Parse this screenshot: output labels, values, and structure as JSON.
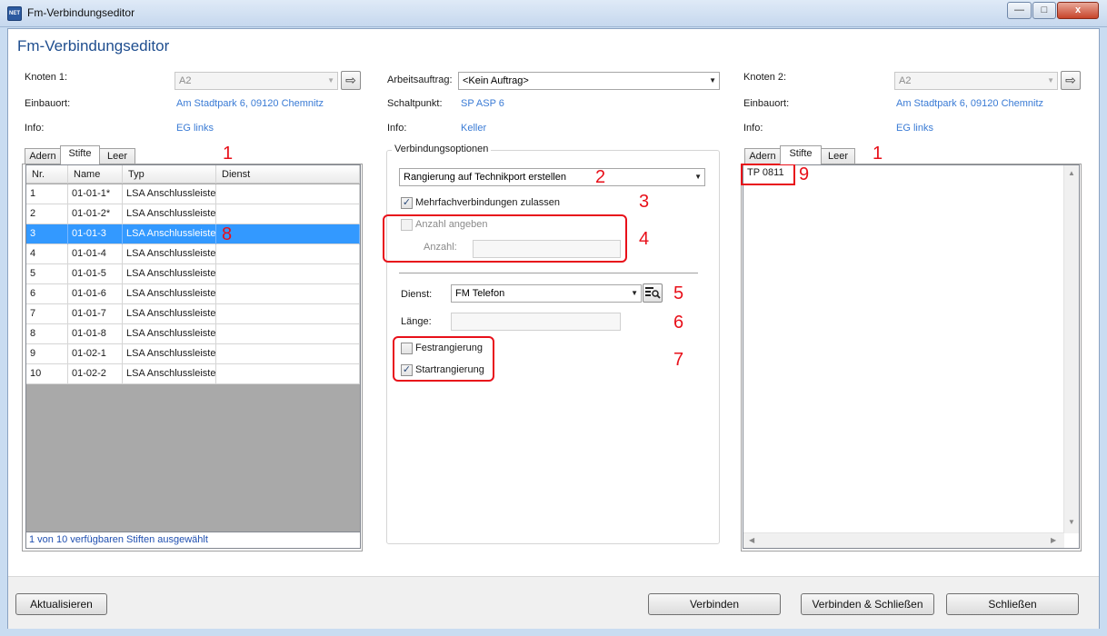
{
  "window": {
    "title": "Fm-Verbindungseditor",
    "app_icon_text": "NET",
    "minimize_glyph": "—",
    "maximize_glyph": "□",
    "close_glyph": "x"
  },
  "heading": "Fm-Verbindungseditor",
  "left": {
    "knoten_label": "Knoten 1:",
    "knoten_value": "A2",
    "einbauort_label": "Einbauort:",
    "einbauort_value": "Am Stadtpark 6, 09120 Chemnitz",
    "info_label": "Info:",
    "info_value": "EG links",
    "tabs": [
      {
        "label": "Adern",
        "active": false
      },
      {
        "label": "Stifte",
        "active": true
      },
      {
        "label": "Leer",
        "active": false
      }
    ],
    "grid": {
      "columns": [
        "Nr.",
        "Name",
        "Typ",
        "Dienst"
      ],
      "rows": [
        {
          "nr": "1",
          "name": "01-01-1*",
          "typ": "LSA Anschlussleiste",
          "dienst": "",
          "selected": false
        },
        {
          "nr": "2",
          "name": "01-01-2*",
          "typ": "LSA Anschlussleiste",
          "dienst": "",
          "selected": false
        },
        {
          "nr": "3",
          "name": "01-01-3",
          "typ": "LSA Anschlussleiste",
          "dienst": "",
          "selected": true
        },
        {
          "nr": "4",
          "name": "01-01-4",
          "typ": "LSA Anschlussleiste",
          "dienst": "",
          "selected": false
        },
        {
          "nr": "5",
          "name": "01-01-5",
          "typ": "LSA Anschlussleiste",
          "dienst": "",
          "selected": false
        },
        {
          "nr": "6",
          "name": "01-01-6",
          "typ": "LSA Anschlussleiste",
          "dienst": "",
          "selected": false
        },
        {
          "nr": "7",
          "name": "01-01-7",
          "typ": "LSA Anschlussleiste",
          "dienst": "",
          "selected": false
        },
        {
          "nr": "8",
          "name": "01-01-8",
          "typ": "LSA Anschlussleiste",
          "dienst": "",
          "selected": false
        },
        {
          "nr": "9",
          "name": "01-02-1",
          "typ": "LSA Anschlussleiste",
          "dienst": "",
          "selected": false
        },
        {
          "nr": "10",
          "name": "01-02-2",
          "typ": "LSA Anschlussleiste",
          "dienst": "",
          "selected": false
        }
      ]
    },
    "status": "1 von 10 verfügbaren Stiften ausgewählt"
  },
  "middle": {
    "arbeitsauftrag_label": "Arbeitsauftrag:",
    "arbeitsauftrag_value": "<Kein Auftrag>",
    "schaltpunkt_label": "Schaltpunkt:",
    "schaltpunkt_value": "SP ASP 6",
    "info_label": "Info:",
    "info_value": "Keller",
    "group_title": "Verbindungsoptionen",
    "rangierung_value": "Rangierung auf Technikport erstellen",
    "mehrfach_label": "Mehrfachverbindungen zulassen",
    "mehrfach_checked": true,
    "anzahl_angeben_label": "Anzahl angeben",
    "anzahl_angeben_checked": false,
    "anzahl_label": "Anzahl:",
    "anzahl_value": "",
    "dienst_label": "Dienst:",
    "dienst_value": "FM Telefon",
    "laenge_label": "Länge:",
    "laenge_value": "",
    "fest_label": "Festrangierung",
    "fest_checked": false,
    "start_label": "Startrangierung",
    "start_checked": true
  },
  "right": {
    "knoten_label": "Knoten 2:",
    "knoten_value": "A2",
    "einbauort_label": "Einbauort:",
    "einbauort_value": "Am Stadtpark 6, 09120 Chemnitz",
    "info_label": "Info:",
    "info_value": "EG links",
    "tabs": [
      {
        "label": "Adern",
        "active": false
      },
      {
        "label": "Stifte",
        "active": true
      },
      {
        "label": "Leer",
        "active": false
      }
    ],
    "list_items": [
      "TP 0811"
    ]
  },
  "annotations": {
    "n1": "1",
    "n2": "2",
    "n3": "3",
    "n4": "4",
    "n5": "5",
    "n6": "6",
    "n7": "7",
    "n8": "8",
    "n9": "9",
    "n1b": "1"
  },
  "buttons": {
    "aktualisieren": "Aktualisieren",
    "verbinden": "Verbinden",
    "verbinden_schliessen": "Verbinden & Schließen",
    "schliessen": "Schließen"
  },
  "colors": {
    "accent": "#3399ff",
    "link": "#3a7bd5",
    "annotation_red": "#e8101a",
    "heading_blue": "#1f4e8f"
  }
}
